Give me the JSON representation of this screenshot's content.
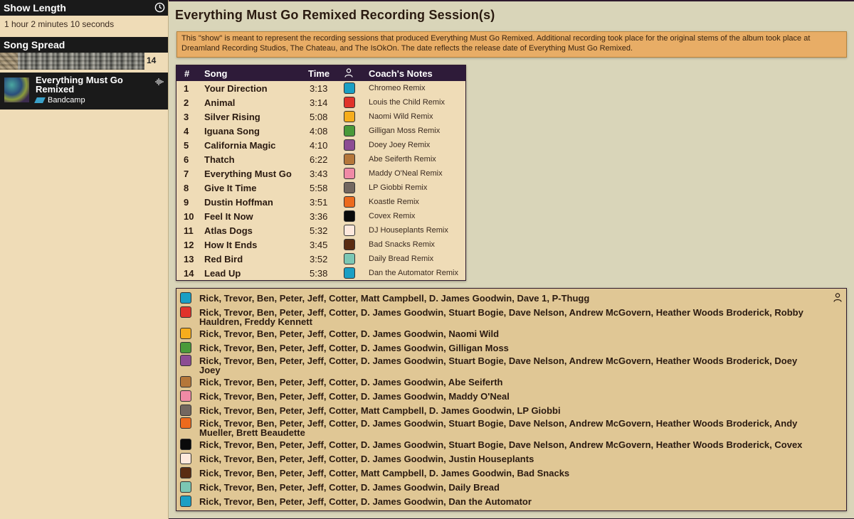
{
  "sidebar": {
    "show_length_title": "Show Length",
    "show_length_value": "1 hour 2 minutes 10 seconds",
    "song_spread_title": "Song Spread",
    "song_spread_count": "14",
    "album": {
      "title": "Everything Must Go Remixed",
      "source": "Bandcamp"
    }
  },
  "main": {
    "title": "Everything Must Go Remixed Recording Session(s)",
    "note": "This \"show\" is meant to represent the recording sessions that produced Everything Must Go Remixed. Additional recording took place for the original stems of the album took place at Dreamland Recording Studios, The Chateau, and The IsOkOn. The date reflects the release date of Everything Must Go Remixed."
  },
  "tracklist": {
    "headers": {
      "num": "#",
      "song": "Song",
      "time": "Time",
      "coach": "Coach's Notes"
    },
    "rows": [
      {
        "num": "1",
        "song": "Your Direction",
        "time": "3:13",
        "color": "#1a9fc4",
        "coach": "Chromeo Remix"
      },
      {
        "num": "2",
        "song": "Animal",
        "time": "3:14",
        "color": "#e0332b",
        "coach": "Louis the Child Remix"
      },
      {
        "num": "3",
        "song": "Silver Rising",
        "time": "5:08",
        "color": "#f6ad1c",
        "coach": "Naomi Wild Remix"
      },
      {
        "num": "4",
        "song": "Iguana Song",
        "time": "4:08",
        "color": "#4a9a3a",
        "coach": "Gilligan Moss Remix"
      },
      {
        "num": "5",
        "song": "California Magic",
        "time": "4:10",
        "color": "#8c4c93",
        "coach": "Doey Joey Remix"
      },
      {
        "num": "6",
        "song": "Thatch",
        "time": "6:22",
        "color": "#b5773a",
        "coach": "Abe Seiferth Remix"
      },
      {
        "num": "7",
        "song": "Everything Must Go",
        "time": "3:43",
        "color": "#f08aa6",
        "coach": "Maddy O'Neal Remix"
      },
      {
        "num": "8",
        "song": "Give It Time",
        "time": "5:58",
        "color": "#736760",
        "coach": "LP Giobbi Remix"
      },
      {
        "num": "9",
        "song": "Dustin Hoffman",
        "time": "3:51",
        "color": "#ec6a1d",
        "coach": "Koastle Remix"
      },
      {
        "num": "10",
        "song": "Feel It Now",
        "time": "3:36",
        "color": "#0a0a0a",
        "coach": "Covex Remix"
      },
      {
        "num": "11",
        "song": "Atlas Dogs",
        "time": "5:32",
        "color": "#fde8dc",
        "coach": "DJ Houseplants Remix"
      },
      {
        "num": "12",
        "song": "How It Ends",
        "time": "3:45",
        "color": "#5a2c12",
        "coach": "Bad Snacks Remix"
      },
      {
        "num": "13",
        "song": "Red Bird",
        "time": "3:52",
        "color": "#7bc7b4",
        "coach": "Daily Bread Remix"
      },
      {
        "num": "14",
        "song": "Lead Up",
        "time": "5:38",
        "color": "#1a9fc4",
        "coach": "Dan the Automator Remix"
      }
    ]
  },
  "lineups": [
    {
      "color": "#1a9fc4",
      "names": "Rick, Trevor, Ben, Peter, Jeff, Cotter, Matt Campbell, D. James Goodwin, Dave 1, P-Thugg"
    },
    {
      "color": "#e0332b",
      "names": "Rick, Trevor, Ben, Peter, Jeff, Cotter, D. James Goodwin, Stuart Bogie, Dave Nelson, Andrew McGovern, Heather Woods Broderick, Robby Hauldren, Freddy Kennett"
    },
    {
      "color": "#f6ad1c",
      "names": "Rick, Trevor, Ben, Peter, Jeff, Cotter, D. James Goodwin, Naomi Wild"
    },
    {
      "color": "#4a9a3a",
      "names": "Rick, Trevor, Ben, Peter, Jeff, Cotter, D. James Goodwin, Gilligan Moss"
    },
    {
      "color": "#8c4c93",
      "names": "Rick, Trevor, Ben, Peter, Jeff, Cotter, D. James Goodwin, Stuart Bogie, Dave Nelson, Andrew McGovern, Heather Woods Broderick, Doey Joey"
    },
    {
      "color": "#b5773a",
      "names": "Rick, Trevor, Ben, Peter, Jeff, Cotter, D. James Goodwin, Abe Seiferth"
    },
    {
      "color": "#f08aa6",
      "names": "Rick, Trevor, Ben, Peter, Jeff, Cotter, D. James Goodwin, Maddy O'Neal"
    },
    {
      "color": "#736760",
      "names": "Rick, Trevor, Ben, Peter, Jeff, Cotter, Matt Campbell, D. James Goodwin, LP Giobbi"
    },
    {
      "color": "#ec6a1d",
      "names": "Rick, Trevor, Ben, Peter, Jeff, Cotter, D. James Goodwin, Stuart Bogie, Dave Nelson, Andrew McGovern, Heather Woods Broderick, Andy Mueller, Brett Beaudette"
    },
    {
      "color": "#0a0a0a",
      "names": "Rick, Trevor, Ben, Peter, Jeff, Cotter, D. James Goodwin, Stuart Bogie, Dave Nelson, Andrew McGovern, Heather Woods Broderick, Covex"
    },
    {
      "color": "#fde8dc",
      "names": "Rick, Trevor, Ben, Peter, Jeff, Cotter, D. James Goodwin, Justin Houseplants"
    },
    {
      "color": "#5a2c12",
      "names": "Rick, Trevor, Ben, Peter, Jeff, Cotter, Matt Campbell, D. James Goodwin, Bad Snacks"
    },
    {
      "color": "#7bc7b4",
      "names": "Rick, Trevor, Ben, Peter, Jeff, Cotter, D. James Goodwin, Daily Bread"
    },
    {
      "color": "#1a9fc4",
      "names": "Rick, Trevor, Ben, Peter, Jeff, Cotter, D. James Goodwin, Dan the Automator"
    }
  ],
  "icons": {
    "clock": "clock-icon",
    "person": "person-icon",
    "waveform": "waveform-icon",
    "bandcamp": "bandcamp-icon"
  }
}
